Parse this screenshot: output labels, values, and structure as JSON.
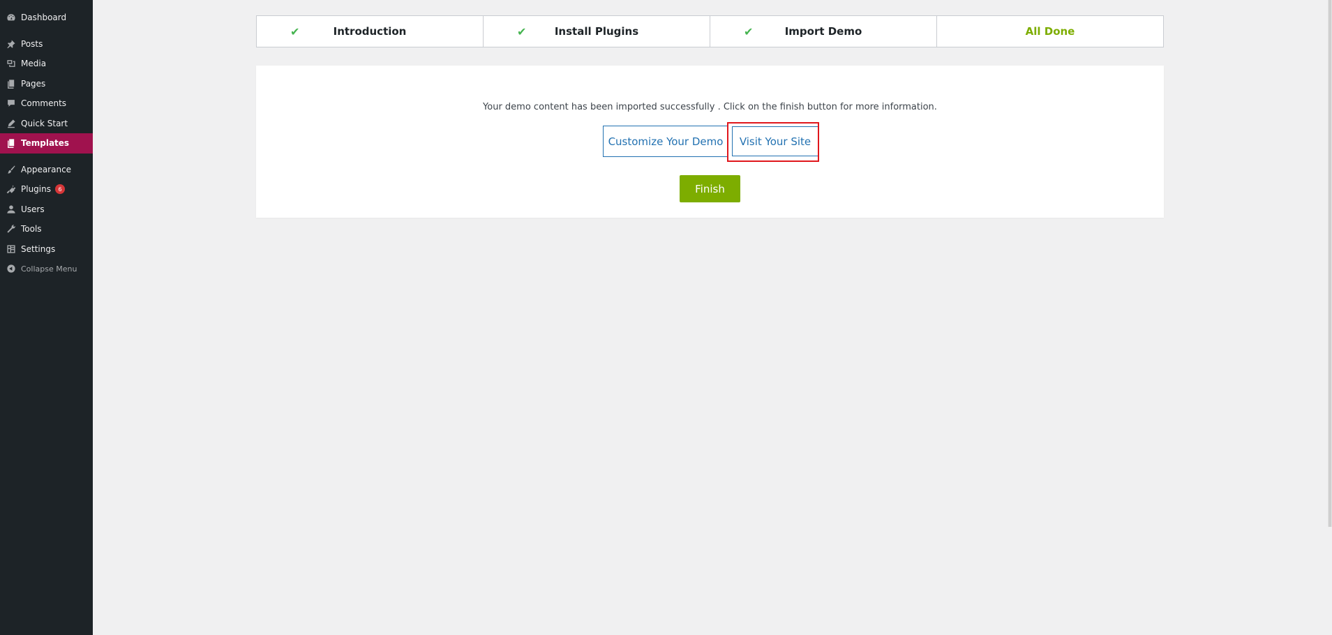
{
  "sidebar": {
    "items": [
      {
        "label": "Dashboard",
        "icon": "dashboard-icon"
      },
      {
        "label": "Posts",
        "icon": "pushpin-icon"
      },
      {
        "label": "Media",
        "icon": "media-icon"
      },
      {
        "label": "Pages",
        "icon": "pages-icon"
      },
      {
        "label": "Comments",
        "icon": "comment-icon"
      },
      {
        "label": "Quick Start",
        "icon": "quick-start-icon"
      },
      {
        "label": "Templates",
        "icon": "templates-icon"
      },
      {
        "label": "Appearance",
        "icon": "paintbrush-icon"
      },
      {
        "label": "Plugins",
        "icon": "plugin-icon",
        "badge": "6"
      },
      {
        "label": "Users",
        "icon": "user-icon"
      },
      {
        "label": "Tools",
        "icon": "wrench-icon"
      },
      {
        "label": "Settings",
        "icon": "settings-icon"
      },
      {
        "label": "Collapse Menu",
        "icon": "collapse-icon"
      }
    ]
  },
  "steps": [
    {
      "label": "Introduction",
      "done": true
    },
    {
      "label": "Install Plugins",
      "done": true
    },
    {
      "label": "Import Demo",
      "done": true
    },
    {
      "label": "All Done",
      "done": false
    }
  ],
  "content": {
    "message": "Your demo content has been imported successfully . Click on the finish button for more information.",
    "customize_label": "Customize Your Demo",
    "visit_label": "Visit Your Site",
    "finish_label": "Finish"
  },
  "colors": {
    "sidebar_bg": "#1d2327",
    "active_menu": "#a0124e",
    "accent_green": "#7dad00",
    "check_green": "#46b450",
    "link_blue": "#2271b1",
    "highlight_red": "#e0161c"
  }
}
